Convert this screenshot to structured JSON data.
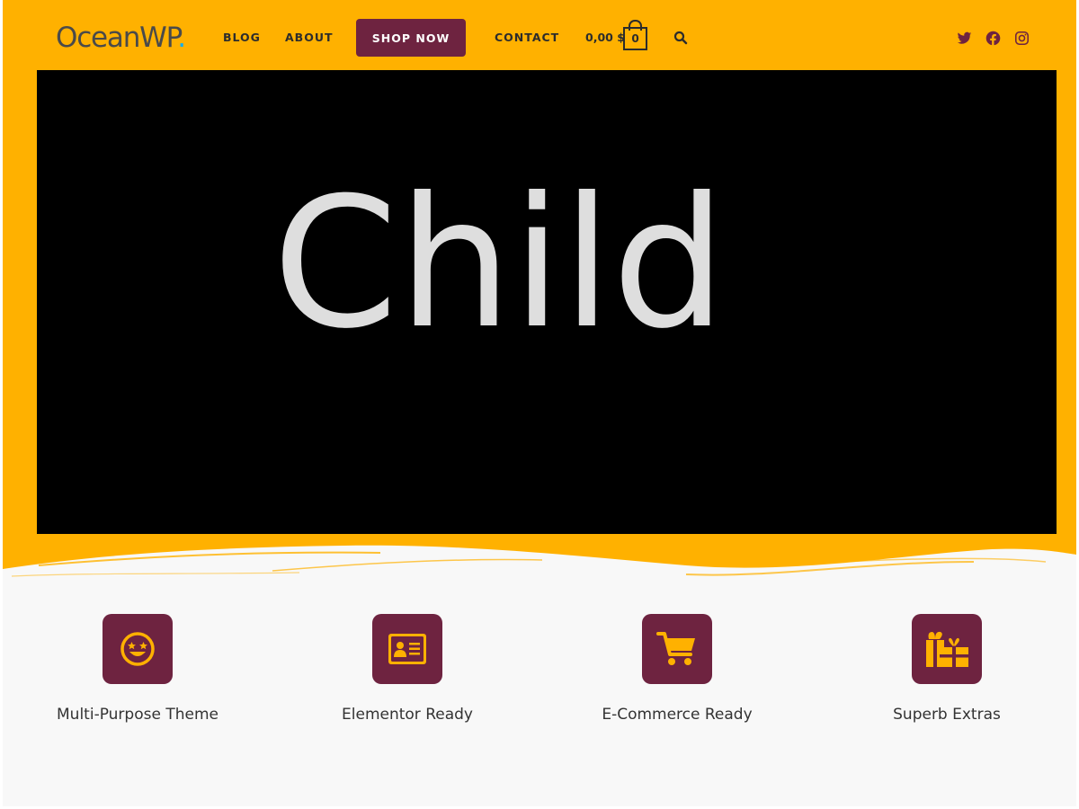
{
  "header": {
    "logo_text": "OceanWP",
    "logo_dot": ".",
    "nav": {
      "blog": "BLOG",
      "about": "ABOUT",
      "shop_now": "SHOP NOW",
      "contact": "CONTACT"
    },
    "cart_total": "0,00 $",
    "cart_count": "0",
    "social": [
      "twitter-icon",
      "facebook-icon",
      "instagram-icon"
    ]
  },
  "hero": {
    "video_title": "Child"
  },
  "features": [
    {
      "label": "Multi-Purpose Theme",
      "icon": "smiley-star-eyes-icon"
    },
    {
      "label": "Elementor Ready",
      "icon": "id-card-icon"
    },
    {
      "label": "E-Commerce Ready",
      "icon": "shopping-cart-icon"
    },
    {
      "label": "Superb Extras",
      "icon": "gifts-icon"
    }
  ],
  "colors": {
    "accent": "#ffb100",
    "brand": "#6e2340",
    "logo_dot": "#13aff0",
    "background": "#f8f8f8"
  }
}
